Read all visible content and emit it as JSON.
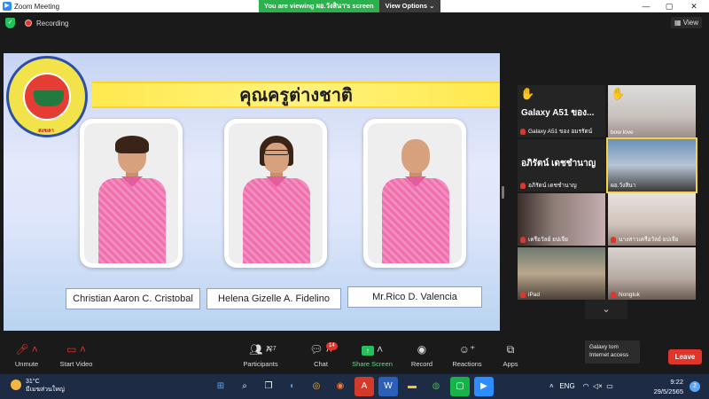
{
  "window": {
    "title": "Zoom Meeting",
    "minimize": "—",
    "maximize": "▢",
    "close": "✕"
  },
  "share_banner": {
    "viewing": "You are viewing ผอ.วังสินา's screen",
    "view_options": "View Options ⌄"
  },
  "topbar": {
    "recording": "Recording",
    "view": "View"
  },
  "slide": {
    "heading": "คุณครูต่างชาติ",
    "logo_caption": "สงขลา",
    "teachers": [
      {
        "name": "Christian Aaron C. Cristobal"
      },
      {
        "name": "Helena Gizelle A. Fidelino"
      },
      {
        "name": "Mr.Rico D. Valencia"
      }
    ]
  },
  "participants_panel": {
    "tiles": [
      {
        "big_name": "Galaxy A51 ของ...",
        "label": "Galaxy A51 ของ อมรรัตน์",
        "hand": "✋",
        "has_video": false
      },
      {
        "big_name": "",
        "label": "bow love",
        "hand": "✋",
        "has_video": true
      },
      {
        "big_name": "อภิรัตน์ เดชชำนาญ",
        "label": "อภิรัตน์ เดชชำนาญ",
        "hand": "",
        "has_video": false
      },
      {
        "big_name": "",
        "label": "ผอ.วังสินา",
        "hand": "",
        "has_video": true,
        "active": true
      },
      {
        "big_name": "",
        "label": "เครือวัลย์ ยปเจีย",
        "hand": "",
        "has_video": true
      },
      {
        "big_name": "",
        "label": "นางสาวเครือวัลย์ ยปเจีย",
        "hand": "",
        "has_video": true
      },
      {
        "big_name": "",
        "label": "iPad",
        "hand": "",
        "has_video": true
      },
      {
        "big_name": "",
        "label": "Nongluk",
        "hand": "",
        "has_video": true
      }
    ],
    "more_chevron": "⌄"
  },
  "toolbar": {
    "unmute": "Unmute",
    "start_video": "Start Video",
    "participants": "Participants",
    "participants_count": "127",
    "chat": "Chat",
    "chat_badge": "14",
    "share_screen": "Share Screen",
    "record": "Record",
    "reactions": "Reactions",
    "apps": "Apps",
    "leave": "Leave"
  },
  "tooltip": {
    "line1": "Galaxy tom",
    "line2": "Internet access"
  },
  "taskbar": {
    "temp": "31°C",
    "weather_desc": "มีเมฆส่วนใหญ่",
    "lang": "ENG",
    "time": "9:22",
    "date": "29/5/2565",
    "notifications": "2"
  },
  "colors": {
    "zoom_blue": "#2d8cff",
    "share_green": "#23c05b",
    "leave_red": "#e0352b",
    "ribbon_yellow": "#ffe94f",
    "shirt_pink": "#f06fae"
  }
}
